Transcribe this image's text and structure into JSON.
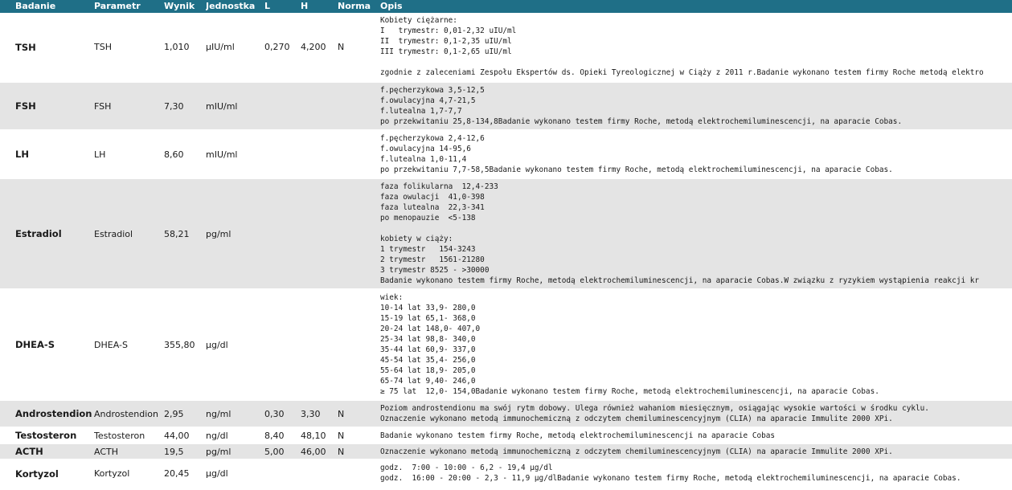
{
  "headers": {
    "badanie": "Badanie",
    "parametr": "Parametr",
    "wynik": "Wynik",
    "jednostka": "Jednostka",
    "l": "L",
    "h": "H",
    "norma": "Norma",
    "opis": "Opis"
  },
  "colors": {
    "header_bg": "#1f6f87",
    "row_shaded": "#e4e4e4"
  },
  "rows": [
    {
      "badanie": "TSH",
      "parametr": "TSH",
      "wynik": "1,010",
      "jednostka": "µIU/ml",
      "l": "0,270",
      "h": "4,200",
      "norma": "N",
      "opis": "Kobiety ciężarne:\nI   trymestr: 0,01-2,32 uIU/ml\nII  trymestr: 0,1-2,35 uIU/ml\nIII trymestr: 0,1-2,65 uIU/ml\n\nzgodnie z zaleceniami Zespołu Ekspertów ds. Opieki Tyreologicznej w Ciąży z 2011 r.Badanie wykonano testem firmy Roche metodą elektro"
    },
    {
      "badanie": "FSH",
      "parametr": "FSH",
      "wynik": "7,30",
      "jednostka": "mIU/ml",
      "l": "",
      "h": "",
      "norma": "",
      "opis": "f.pęcherzykowa 3,5-12,5\nf.owulacyjna 4,7-21,5\nf.lutealna 1,7-7,7\npo przekwitaniu 25,8-134,8Badanie wykonano testem firmy Roche, metodą elektrochemiluminescencji, na aparacie Cobas."
    },
    {
      "badanie": "LH",
      "parametr": "LH",
      "wynik": "8,60",
      "jednostka": "mIU/ml",
      "l": "",
      "h": "",
      "norma": "",
      "opis": "f.pęcherzykowa 2,4-12,6\nf.owulacyjna 14-95,6\nf.lutealna 1,0-11,4\npo przekwitaniu 7,7-58,5Badanie wykonano testem firmy Roche, metodą elektrochemiluminescencji, na aparacie Cobas."
    },
    {
      "badanie": "Estradiol",
      "parametr": "Estradiol",
      "wynik": "58,21",
      "jednostka": "pg/ml",
      "l": "",
      "h": "",
      "norma": "",
      "opis": "faza folikularna  12,4-233\nfaza owulacji  41,0-398\nfaza lutealna  22,3-341\npo menopauzie  <5-138\n\nkobiety w ciąży:\n1 trymestr   154-3243\n2 trymestr   1561-21280\n3 trymestr 8525 - >30000\nBadanie wykonano testem firmy Roche, metodą elektrochemiluminescencji, na aparacie Cobas.W związku z ryzykiem wystąpienia reakcji kr"
    },
    {
      "badanie": "DHEA-S",
      "parametr": "DHEA-S",
      "wynik": "355,80",
      "jednostka": "µg/dl",
      "l": "",
      "h": "",
      "norma": "",
      "opis": "wiek:\n10-14 lat 33,9- 280,0\n15-19 lat 65,1- 368,0\n20-24 lat 148,0- 407,0\n25-34 lat 98,8- 340,0\n35-44 lat 60,9- 337,0\n45-54 lat 35,4- 256,0\n55-64 lat 18,9- 205,0\n65-74 lat 9,40- 246,0\n≥ 75 lat  12,0- 154,0Badanie wykonano testem firmy Roche, metodą elektrochemiluminescencji, na aparacie Cobas."
    },
    {
      "badanie": "Androstendion",
      "parametr": "Androstendion",
      "wynik": "2,95",
      "jednostka": "ng/ml",
      "l": "0,30",
      "h": "3,30",
      "norma": "N",
      "opis": "Poziom androstendionu ma swój rytm dobowy. Ulega również wahaniom miesięcznym, osiągając wysokie wartości w środku cyklu.\nOznaczenie wykonano metodą immunochemiczną z odczytem chemiluminescencyjnym (CLIA) na aparacie Immulite 2000 XPi."
    },
    {
      "badanie": "Testosteron",
      "parametr": "Testosteron",
      "wynik": "44,00",
      "jednostka": "ng/dl",
      "l": "8,40",
      "h": "48,10",
      "norma": "N",
      "opis": "Badanie wykonano testem firmy Roche, metodą elektrochemiluminescencji na aparacie Cobas"
    },
    {
      "badanie": "ACTH",
      "parametr": "ACTH",
      "wynik": "19,5",
      "jednostka": "pg/ml",
      "l": "5,00",
      "h": "46,00",
      "norma": "N",
      "opis": "Oznaczenie wykonano metodą immunochemiczną z odczytem chemiluminescencyjnym (CLIA) na aparacie Immulite 2000 XPi."
    },
    {
      "badanie": "Kortyzol",
      "parametr": "Kortyzol",
      "wynik": "20,45",
      "jednostka": "µg/dl",
      "l": "",
      "h": "",
      "norma": "",
      "opis": "godz.  7:00 - 10:00 - 6,2 - 19,4 µg/dl\ngodz.  16:00 - 20:00 - 2,3 - 11,9 µg/dlBadanie wykonano testem firmy Roche, metodą elektrochemiluminescencji, na aparacie Cobas."
    }
  ]
}
